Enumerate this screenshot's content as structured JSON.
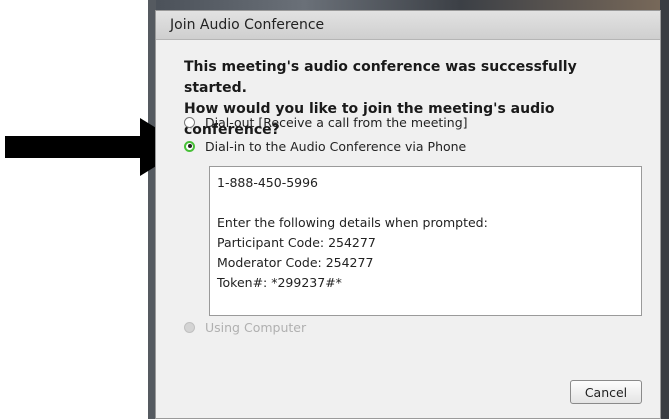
{
  "dialog": {
    "title": "Join Audio Conference",
    "prompt_line1": "This meeting's audio conference was successfully started.",
    "prompt_line2": "How would you like to join the meeting's audio conference?"
  },
  "options": {
    "dial_out": "Dial-out [Receive a call from the meeting]",
    "dial_in": "Dial-in to the Audio Conference via Phone",
    "using_computer": "Using Computer"
  },
  "details": {
    "phone": "1-888-450-5996",
    "instructions": "Enter the following details when prompted:",
    "participant_code": "Participant Code: 254277",
    "moderator_code": "Moderator Code: 254277",
    "token": "Token#: *299237#*"
  },
  "buttons": {
    "cancel": "Cancel"
  },
  "colors": {
    "selected_radio_ring": "#48c038",
    "annotation_arrow": "#000000"
  }
}
